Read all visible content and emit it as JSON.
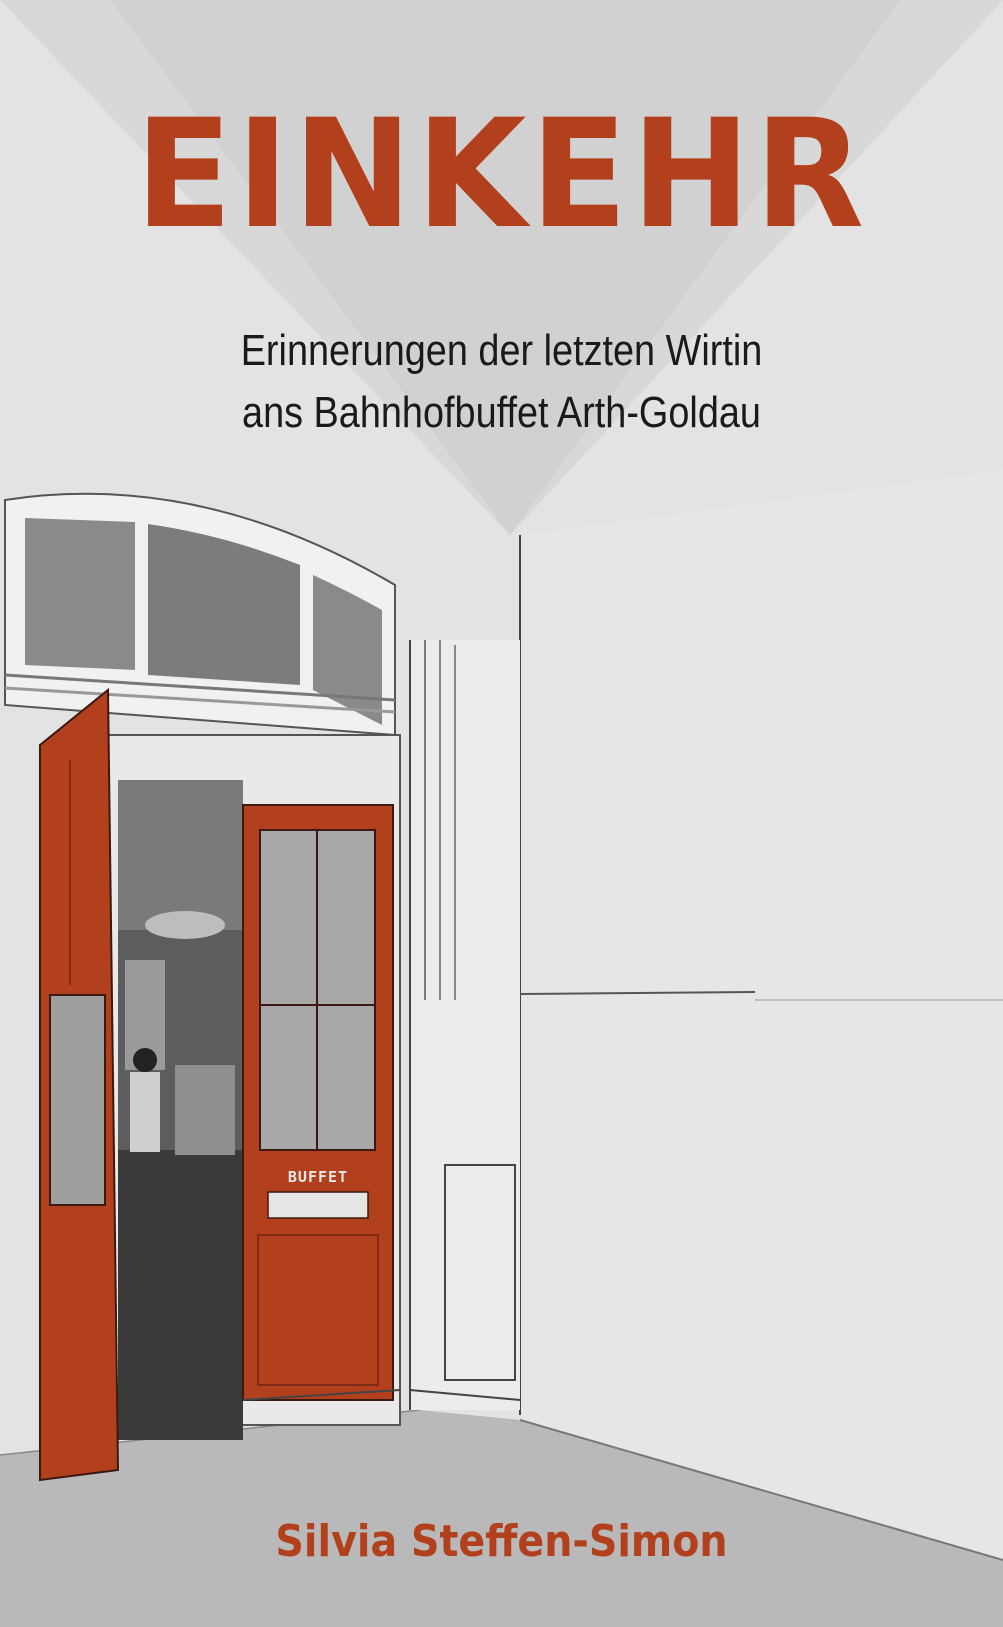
{
  "book": {
    "title": "EINKEHR",
    "subtitle_line1": "Erinnerungen der letzten Wirtin",
    "subtitle_line2": "ans Bahnhofbuffet Arth-Goldau",
    "author": "Silvia Steffen-Simon",
    "door_sign": "BUFFET"
  },
  "colors": {
    "accent": "#b3401c",
    "background": "#e2e2e2",
    "floor": "#b9b9b9",
    "triangle": "#d2d2d2"
  }
}
